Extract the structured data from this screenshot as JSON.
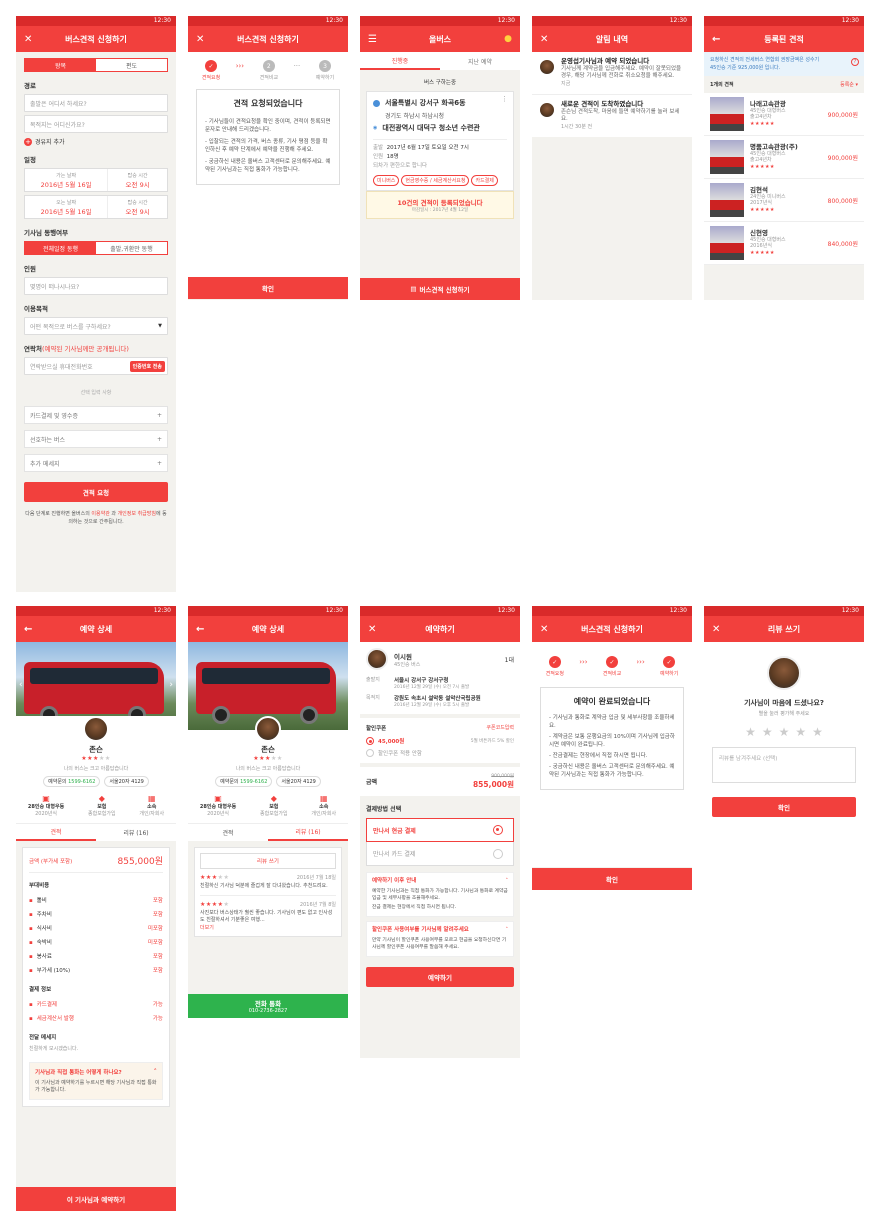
{
  "status": {
    "time": "12:30"
  },
  "s1": {
    "title": "버스견적 신청하기",
    "close": "✕",
    "trip_on": "왕복",
    "trip_off": "편도",
    "route_label": "경로",
    "from_ph": "출발은 어디서 하세요?",
    "to_ph": "목적지는 어디신가요?",
    "add_stop": "경유지 추가",
    "date_label": "일정",
    "go_date_l": "가는 날짜",
    "go_date": "2016년 5월 16일",
    "go_time_l": "탑승 시간",
    "go_time": "오전 9시",
    "back_date_l": "오는 날짜",
    "back_date": "2016년 5월 16일",
    "back_time_l": "탑승 시간",
    "back_time": "오전 9시",
    "driver_label": "기사님 동행여부",
    "driver_on": "전체일정 동행",
    "driver_off": "출발,귀환만 동행",
    "people_label": "인원",
    "people_ph": "몇명이 떠나시나요?",
    "purpose_label": "이용목적",
    "purpose_ph": "어떤 목적으로 버스를 구하세요?",
    "contact_label": "연락처",
    "contact_note": "(예약된 기사님께만 공개됩니다)",
    "contact_ph": "연락받으실 휴대전화번호",
    "verify_btn": "인증번호 전송",
    "optional": "선택 입력 사항",
    "opt1": "카드결제 및 영수증",
    "opt2": "선호하는 버스",
    "opt3": "추가 메세지",
    "submit": "견적 요청",
    "footer1": "다음 단계로 진행하면 올버스의 ",
    "terms": "이용약관",
    "footer2": " 과 ",
    "privacy": "개인정보 취급방침",
    "footer3": "에 동의하는 것으로 간주됩니다."
  },
  "s2": {
    "title": "버스견적 신청하기",
    "close": "✕",
    "step1": "견적요청",
    "step2": "견적비교",
    "step3": "예약하기",
    "n2": "2",
    "n3": "3",
    "heading": "견적 요청되었습니다",
    "p1": "- 기사님들이 견적요청을 확인 중이며, 견적이 등록되면 문자로 안내해 드리겠습니다.",
    "p2": "- 입찰되는 견적의 가격, 버스 종류, 기사 평점 등을 확인하신 후 예약 단계에서 예약을 진행해 주세요.",
    "p3": "- 궁금하신 내용은 올버스 고객센터로 문의해주세요. 예약된 기사님과는 직접 통화가 가능합니다.",
    "confirm": "확인"
  },
  "s3": {
    "title": "올버스",
    "tab1": "진행중",
    "tab2": "지난 예약",
    "card_head": "버스 구하는중",
    "from": "서울특별시 강서구 화곡6동",
    "via": "경기도 하남시 하남시청",
    "to": "대전광역시 대덕구 청소년 수련관",
    "dep_l": "출발",
    "dep": "2017년 6월 17일 토요일 오전 7시",
    "ppl_l": "인원",
    "ppl": "18명",
    "round": "되차가 편한으로 합니다",
    "tag1": "미니버스",
    "tag2": "현금영수증 / 세금계산서요청",
    "tag3": "카드결제",
    "quotes": "10건의 견적이 등록되었습니다",
    "updated": "마감일시 : 2017년 4월 12일",
    "new_btn": "버스견적 신청하기"
  },
  "s4": {
    "title": "알림 내역",
    "close": "✕",
    "n1_title": "운영섭기사님과 예약 되었습니다",
    "n1_body": "기사님께 계약금을 입금해주세요. 예약이 잘못되었을 경우, 해당 기사님께 전화로 취소요청을 해주세요.",
    "n1_time": "지금",
    "n2_title": "새로운 견적이 도착하였습니다",
    "n2_body": "존슨님 견적도착, 마음에 들면 예약하기를 눌러 보세요.",
    "n2_time": "1시간 30분 전"
  },
  "s5": {
    "title": "등록된 견적",
    "info1": "요청하신 견적의 전세버스 연합회 권장금액은 성수기",
    "info2": "45인승 기준 925,000원 입니다.",
    "count": "1개의 견적",
    "sort": "등록순 ▾",
    "items": [
      {
        "name": "나래고속관광",
        "sub1": "45인승 대형버스",
        "sub2": "출고4년차",
        "stars": "★★★★★",
        "price": "900,000원"
      },
      {
        "name": "명품고속관광(주)",
        "sub1": "45인승 대형버스",
        "sub2": "출고4년차",
        "stars": "★★★★★",
        "price": "900,000원"
      },
      {
        "name": "김현석",
        "sub1": "24인승 미니버스",
        "sub2": "2017년식",
        "stars": "★★★★★",
        "price": "800,000원"
      },
      {
        "name": "신현영",
        "sub1": "45인승 대형버스",
        "sub2": "2016년식",
        "stars": "★★★★★",
        "price": "840,000원"
      }
    ]
  },
  "s6": {
    "title": "예약 상세",
    "name": "존슨",
    "bio": "나의 버스는 크고 아름답습니다",
    "phone_l": "예약문의",
    "phone": "1599-6162",
    "plate": "서울20자 4129",
    "f1_title": "28인승 대형우등",
    "f1_sub": "2020년식",
    "f2_title": "보험",
    "f2_sub": "종합보험가입",
    "f3_title": "소속",
    "f3_sub": "개인/자회사",
    "tab1": "견적",
    "tab2": "리뷰 (16)",
    "amount_l": "금액 (부가세 포함)",
    "amount": "855,000원",
    "incl_title": "부대비용",
    "incl": [
      {
        "k": "톨비",
        "v": "포함"
      },
      {
        "k": "주차비",
        "v": "포함"
      },
      {
        "k": "식사비",
        "v": "미포함"
      },
      {
        "k": "숙박비",
        "v": "미포함"
      },
      {
        "k": "봉사료",
        "v": "포함"
      },
      {
        "k": "부가세 (10%)",
        "v": "포함"
      }
    ],
    "pay_title": "결제 정보",
    "pay": [
      {
        "k": "카드결제",
        "v": "가능"
      },
      {
        "k": "세금계산서 발행",
        "v": "가능"
      }
    ],
    "msg_title": "전달 메세지",
    "msg": "친절하게 모시겠습니다.",
    "faq_q": "기사님과 직접 통화는 어떻게 하나요?",
    "faq_a": "이 기사님과 예약하기를 누르시면 해당 기사님과 직접 통화가 가능합니다.",
    "book": "이 기사님과 예약하기"
  },
  "s7": {
    "title": "예약 상세",
    "name": "존슨",
    "bio": "나의 버스는 크고 아름답습니다",
    "phone_l": "예약문의",
    "phone": "1599-6162",
    "plate": "서울20자 4129",
    "tab1": "견적",
    "tab2": "리뷰 (16)",
    "write": "리뷰 쓰기",
    "r1_date": "2016년 7월 18일",
    "r1_body": "친절하신 기사님 덕분에 즐겁게 잘 다녀왔습니다. 추천드려요.",
    "r2_date": "2016년 7월 8일",
    "r2_body": "사진보다 버스상태가 훨씬 좋습니다. 기사님이 편도 없고 인사성도 친절하셔서 기분좋은 여행...",
    "more": "더보기",
    "call": "전화 통화",
    "call_num": "010-2736-2827"
  },
  "s8": {
    "title": "예약하기",
    "close": "✕",
    "driver": "이시원",
    "bus": "45인승 버스",
    "count": "1대",
    "dep_l": "출발지",
    "dep": "서울시 강서구 강서구청",
    "dep_time": "2016년 12월 29일 (수) 오전 7시 출발",
    "dest_l": "목적지",
    "dest": "강원도 속초시 설악동 설악산국립공원",
    "dest_time": "2016년 12월 29일 (수) 오후 5시 출발",
    "coupon_l": "할인쿠폰",
    "coupon_more": "쿠폰코드입력",
    "coupon_val": "45,000원",
    "coupon_note": "5월 버튼카드 5% 할인",
    "no_coupon": "할인쿠폰 적용 안함",
    "total_l": "금액",
    "old": "900,000원",
    "total": "855,000원",
    "pm_title": "결제방법 선택",
    "pm1": "만나서 현금 결제",
    "pm2": "만나서 카드 결제",
    "info1_t": "예약하기 이후 안내",
    "info1_b": "예약한 기사님과는 직접 통화가 가능합니다. 기사님과 통화로 계약금 입금 및 세부사항을 조율해주세요.",
    "info1_b2": "잔금 결제는 현장에서 직접 하시면 됩니다.",
    "info2_t": "할인쿠폰 사용여부를 기사님께 알려주세요",
    "info2_b": "만약 기사님이 할인쿠폰 사용여부를 모르고 현금을 요청하신다면 기사님께 할인쿠폰 사용여부를 말씀해 주세요.",
    "book": "예약하기"
  },
  "s9": {
    "title": "버스견적 신청하기",
    "close": "✕",
    "step1": "견적요청",
    "step2": "견적비교",
    "step3": "예약하기",
    "heading": "예약이 완료되었습니다",
    "p1": "- 기사님과 통화로 계약금 입금 및 세부사항을 조율하세요.",
    "p2": "- 계약금은 보통 운행요금의 10%이며 기사님께 입금하시면 예약이 완료됩니다.",
    "p3": "- 잔금결제는 현장에서 직접 하시면 됩니다.",
    "p4": "- 궁금하신 내용은 올버스 고객센터로 문의해주세요. 예약된 기사님과는 직접 통화가 가능합니다.",
    "confirm": "확인"
  },
  "s10": {
    "title": "리뷰 쓰기",
    "close": "✕",
    "q": "기사님이 마음에 드셨나요?",
    "sub": "별을 눌러 평가해 주세요",
    "ph": "리뷰를 남겨주세요 (선택)",
    "confirm": "확인"
  },
  "colors": {
    "accent": "#f2403d"
  }
}
